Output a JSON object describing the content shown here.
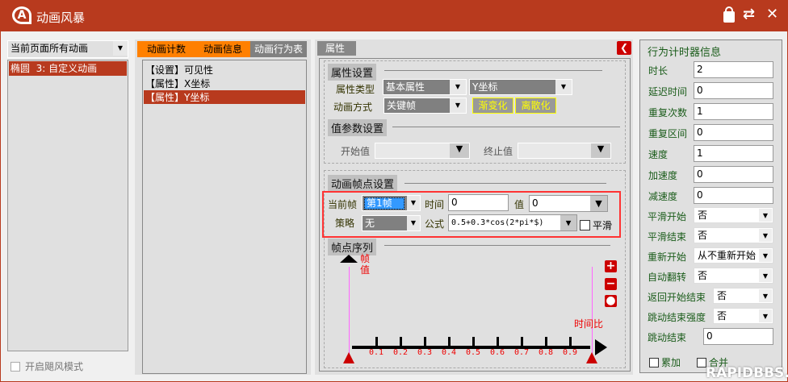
{
  "window": {
    "title": "动画风暴",
    "icons": [
      "lock-icon",
      "sync-icon",
      "close-icon"
    ]
  },
  "left": {
    "scope_select": "当前页面所有动画",
    "items": [
      "椭圆  3: 自定义动画"
    ],
    "hurricane_mode": "开启飓风模式"
  },
  "middle": {
    "tabs": [
      "动画计数",
      "动画信息",
      "动画行为表"
    ],
    "items": [
      "【设置】可见性",
      "【属性】X坐标",
      "【属性】Y坐标"
    ],
    "selected_index": 2
  },
  "props": {
    "header": "属性",
    "attr_section": "属性设置",
    "attr_type_label": "属性类型",
    "attr_type": "基本属性",
    "attr_sub": "Y坐标",
    "anim_mode_label": "动画方式",
    "anim_mode": "关键帧",
    "gradient_btn": "渐变化",
    "discrete_btn": "离散化",
    "value_section": "值参数设置",
    "start_label": "开始值",
    "start_value": "",
    "end_label": "终止值",
    "end_value": "",
    "keyframe_section": "动画帧点设置",
    "current_frame_label": "当前帧",
    "current_frame": "第1帧",
    "time_label": "时间",
    "time_value": "0",
    "value_label": "值",
    "value_value": "0",
    "strategy_label": "策略",
    "strategy": "无",
    "formula_label": "公式",
    "formula": "0.5+0.3*cos(2*pi*$)",
    "smooth_label": "平滑",
    "sequence_section": "帧点序列",
    "y_axis_label": "帧值",
    "x_axis_label": "时间比",
    "ticks": [
      "0.1",
      "0.2",
      "0.3",
      "0.4",
      "0.5",
      "0.6",
      "0.7",
      "0.8",
      "0.9"
    ],
    "keyframes": [
      0,
      1
    ]
  },
  "timer": {
    "title": "行为计时器信息",
    "fields": [
      {
        "label": "时长",
        "value": "2"
      },
      {
        "label": "延迟时间",
        "value": "0"
      },
      {
        "label": "重复次数",
        "value": "1"
      },
      {
        "label": "重复区间",
        "value": "0"
      },
      {
        "label": "速度",
        "value": "1"
      },
      {
        "label": "加速度",
        "value": "0"
      },
      {
        "label": "减速度",
        "value": "0"
      }
    ],
    "selects": [
      {
        "label": "平滑开始",
        "value": "否"
      },
      {
        "label": "平滑结束",
        "value": "否"
      },
      {
        "label": "重新开始",
        "value": "从不重新开始"
      },
      {
        "label": "自动翻转",
        "value": "否"
      },
      {
        "label": "返回开始结束",
        "value": "否"
      },
      {
        "label": "跳动结束强度",
        "value": "否"
      }
    ],
    "bounce_end_label": "跳动结束",
    "bounce_end": "0",
    "accumulate": "累加",
    "merge": "合并"
  },
  "watermark": "RAPIDBBS.CN"
}
